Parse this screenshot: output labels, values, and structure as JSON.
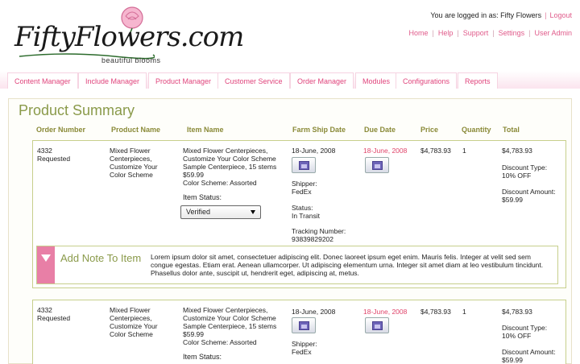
{
  "brand": {
    "logo_text": "FiftyFlowers.com",
    "tagline": "beautiful blooms",
    "accent": "#e05a8a",
    "olive": "#8a9a4a"
  },
  "user": {
    "logged_in_text": "You are logged in as: Fifty Flowers",
    "logout": "Logout"
  },
  "top_links": [
    "Home",
    "Help",
    "Support",
    "Settings",
    "User Admin"
  ],
  "nav_tabs": [
    "Content Manager",
    "Include Manager",
    "Product Manager",
    "Customer Service",
    "Order Manager",
    "Modules",
    "Configurations",
    "Reports"
  ],
  "page": {
    "title": "Product Summary"
  },
  "columns": [
    "Order Number",
    "Product Name",
    "Item Name",
    "Farm Ship Date",
    "Due Date",
    "Price",
    "Quantity",
    "Total"
  ],
  "orders": [
    {
      "order_number": "4332",
      "order_status": "Requested",
      "product_name": [
        "Mixed Flower",
        "Centerpieces,",
        "Customize Your",
        "Color Scheme"
      ],
      "item_name": [
        "Mixed Flower Centerpieces,",
        "Customize Your Color Scheme",
        "Sample Centerpiece, 15 stems",
        "$59.99",
        "Color Scheme: Assorted"
      ],
      "item_status_label": "Item Status:",
      "item_status_value": "Verified",
      "farm_ship_date": "18-June, 2008",
      "shipper_label": "Shipper:",
      "shipper": "FedEx",
      "status_label": "Status:",
      "status": "In Transit",
      "tracking_label": "Tracking Number:",
      "tracking": "93839829202",
      "due_date": "18-June, 2008",
      "price": "$4,783.93",
      "quantity": "1",
      "total": "$4,783.93",
      "discount_type_label": "Discount Type:",
      "discount_type": "10% OFF",
      "discount_amount_label": "Discount Amount:",
      "discount_amount": "$59.99"
    },
    {
      "order_number": "4332",
      "order_status": "Requested",
      "product_name": [
        "Mixed Flower",
        "Centerpieces,",
        "Customize Your",
        "Color Scheme"
      ],
      "item_name": [
        "Mixed Flower Centerpieces,",
        "Customize Your Color Scheme",
        "Sample Centerpiece, 15 stems",
        "$59.99",
        "Color Scheme: Assorted"
      ],
      "item_status_label": "Item Status:",
      "farm_ship_date": "18-June, 2008",
      "shipper_label": "Shipper:",
      "shipper": "FedEx",
      "due_date": "18-June, 2008",
      "price": "$4,783.93",
      "quantity": "1",
      "total": "$4,783.93",
      "discount_type_label": "Discount Type:",
      "discount_type": "10% OFF",
      "discount_amount_label": "Discount Amount:",
      "discount_amount": "$59.99"
    }
  ],
  "note": {
    "label": "Add Note To Item",
    "body": "Lorem ipsum dolor sit amet, consectetuer adipiscing elit. Donec laoreet ipsum eget enim. Mauris felis. Integer at velit sed sem congue egestas. Etiam erat. Aenean ullamcorper. Ut adipiscing elementum urna. Integer sit amet diam at leo vestibulum tincidunt. Phasellus dolor ante, suscipit ut, hendrerit eget, adipiscing at, metus."
  }
}
